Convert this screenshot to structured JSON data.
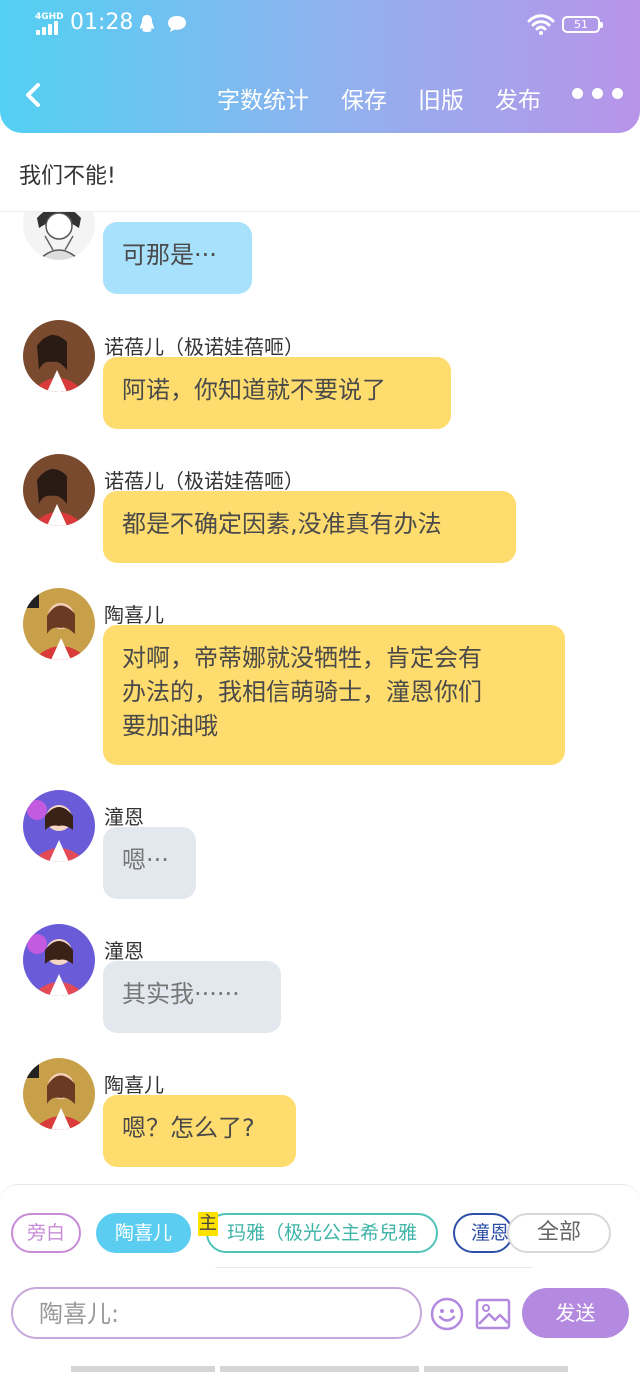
{
  "status_bar": {
    "network": "4GHD",
    "time": "01:28",
    "battery": "51",
    "icons": [
      "signal-icon",
      "qq-icon",
      "chat-icon",
      "wifi-icon",
      "battery-icon"
    ]
  },
  "header": {
    "back_icon": "back-chevron-icon",
    "buttons": {
      "word_count": "字数统计",
      "save": "保存",
      "old_version": "旧版",
      "publish": "发布"
    },
    "more_icon": "more-dots-icon"
  },
  "title": "我们不能!",
  "messages": [
    {
      "speaker": "",
      "text": "可那是···",
      "color": "#a7e1fb",
      "avatar": "sketch-avatar"
    },
    {
      "speaker": "诺蓓儿（极诺娃蓓咂）",
      "text": "阿诺，你知道就不要说了",
      "color": "#ffdc6e",
      "avatar": "photo-avatar"
    },
    {
      "speaker": "诺蓓儿（极诺娃蓓咂）",
      "text": "都是不确定因素,没准真有办法",
      "color": "#ffdc6e",
      "avatar": "photo-avatar"
    },
    {
      "speaker": "陶喜儿",
      "text": "对啊，帝蒂娜就没牺牲，肯定会有\n办法的，我相信萌骑士，潼恩你们\n要加油哦",
      "color": "#ffdc6e",
      "avatar": "photo-avatar"
    },
    {
      "speaker": "潼恩",
      "text": "嗯···",
      "color": "#e3e7ee",
      "avatar": "photo-avatar"
    },
    {
      "speaker": "潼恩",
      "text": "其实我······",
      "color": "#e3e7ee",
      "avatar": "photo-avatar"
    },
    {
      "speaker": "陶喜儿",
      "text": "嗯？怎么了?",
      "color": "#ffdc6e",
      "avatar": "photo-avatar"
    }
  ],
  "role_selector": {
    "narration": "旁白",
    "tao_xier": "陶喜儿",
    "host_badge": "主",
    "maya": "玛雅（极光公主希兒雅",
    "tongen": "潼恩",
    "all": "全部"
  },
  "composer": {
    "placeholder": "陶喜儿:",
    "value": "",
    "emoji_icon": "emoji-icon",
    "image_icon": "image-icon",
    "send": "发送"
  },
  "colors": {
    "header_gradient": [
      "#52d0f3",
      "#b894e9"
    ],
    "bubble_yellow": "#ffdc6e",
    "bubble_blue": "#a7e1fb",
    "bubble_grey": "#e3e7ee",
    "send_button": "#b48ae0"
  }
}
